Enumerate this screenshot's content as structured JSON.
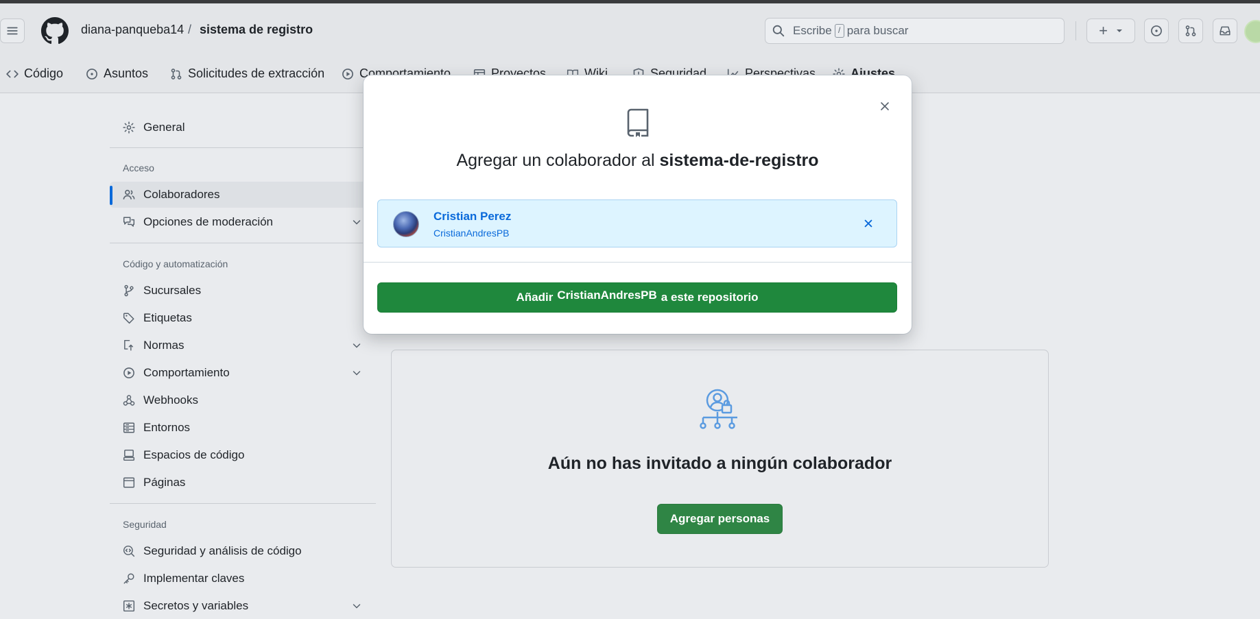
{
  "header": {
    "owner": "diana-panqueba14",
    "separator": "/",
    "repo": "sistema de registro",
    "search_pre": "Escribe",
    "search_key": "/",
    "search_post": "para buscar",
    "plus": "+"
  },
  "tabs": [
    {
      "label": "Código",
      "icon": "code-icon"
    },
    {
      "label": "Asuntos",
      "icon": "issue-icon"
    },
    {
      "label": "Solicitudes de extracción",
      "icon": "pull-request-icon"
    },
    {
      "label": "Comportamiento",
      "icon": "play-icon"
    },
    {
      "label": "Proyectos",
      "icon": "table-icon"
    },
    {
      "label": "Wiki",
      "icon": "book-icon"
    },
    {
      "label": "Seguridad",
      "icon": "shield-icon"
    },
    {
      "label": "Perspectivas",
      "icon": "graph-icon"
    },
    {
      "label": "Ajustes",
      "icon": "gear-icon",
      "active": true
    }
  ],
  "sidebar": {
    "general": "General",
    "access_heading": "Acceso",
    "collaborators": "Colaboradores",
    "moderation": "Opciones de moderación",
    "code_heading": "Código y automatización",
    "branches": "Sucursales",
    "tags": "Etiquetas",
    "rules": "Normas",
    "actions": "Comportamiento",
    "webhooks": "Webhooks",
    "environments": "Entornos",
    "codespaces": "Espacios de código",
    "pages": "Páginas",
    "security_heading": "Seguridad",
    "code_security": "Seguridad y análisis de código",
    "deploy_keys": "Implementar claves",
    "secrets": "Secretos y variables"
  },
  "main": {
    "empty_title": "Aún no has invitado a ningún colaborador",
    "add_people": "Agregar personas"
  },
  "dialog": {
    "title_prefix": "Agregar un colaborador al",
    "title_repo": "sistema-de-registro",
    "user_name": "Cristian Perez",
    "user_login": "CristianAndresPB",
    "add_prefix": "Añadir",
    "add_login": "CristianAndresPB",
    "add_suffix": "a este repositorio"
  },
  "colors": {
    "primary_green": "#1f883d",
    "link_blue": "#0969da",
    "selected_bg": "#ddf4ff"
  }
}
